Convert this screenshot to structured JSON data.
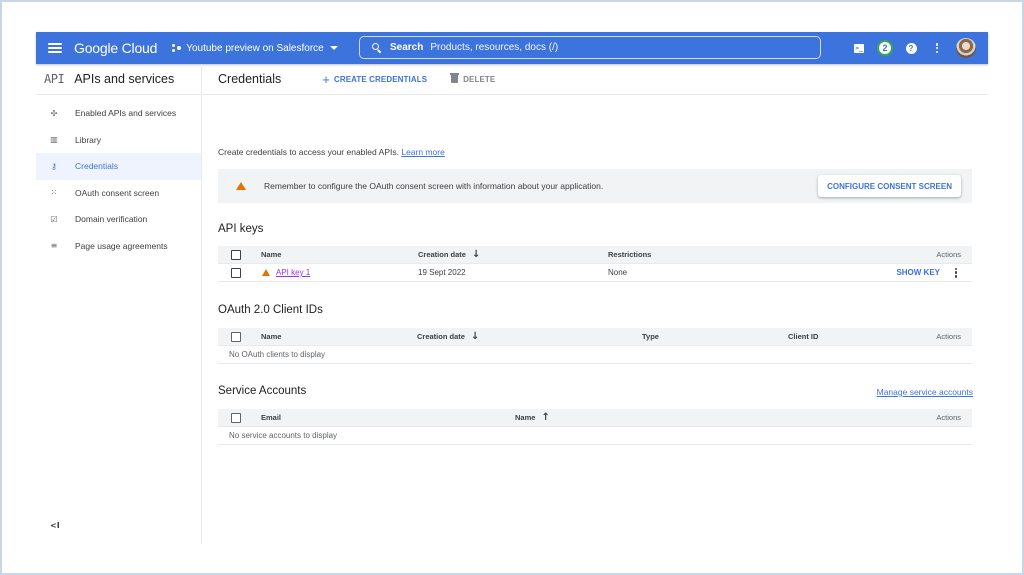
{
  "topbar": {
    "brand": "Google Cloud",
    "project": "Youtube preview on Salesforce",
    "search_label": "Search",
    "search_placeholder": "Products, resources, docs (/)",
    "notification_count": "2",
    "icons": [
      "menu-icon",
      "project-icon",
      "search-icon",
      "cloud-shell-icon",
      "notifications-icon",
      "help-icon",
      "more-vert-icon",
      "avatar"
    ],
    "colors": {
      "bar": "#3d73dc",
      "badge_ring": "#34a853"
    }
  },
  "sidebar": {
    "logo": "API",
    "title": "APIs and services",
    "items": [
      {
        "label": "Enabled APIs and services",
        "icon": "✣",
        "active": false
      },
      {
        "label": "Library",
        "icon": "▥",
        "active": false
      },
      {
        "label": "Credentials",
        "icon": "⚷",
        "active": true
      },
      {
        "label": "OAuth consent screen",
        "icon": "⁙",
        "active": false
      },
      {
        "label": "Domain verification",
        "icon": "☑",
        "active": false
      },
      {
        "label": "Page usage agreements",
        "icon": "≡",
        "active": false
      }
    ],
    "collapse_label": "<I"
  },
  "main": {
    "title": "Credentials",
    "create_label": "CREATE CREDENTIALS",
    "delete_label": "DELETE",
    "intro_text": "Create credentials to access your enabled APIs.",
    "learn_more": "Learn more",
    "banner_text": "Remember to configure the OAuth consent screen with information about your application.",
    "banner_button": "CONFIGURE CONSENT SCREEN"
  },
  "api_keys": {
    "title": "API keys",
    "columns": {
      "name": "Name",
      "created": "Creation date",
      "restrictions": "Restrictions",
      "actions": "Actions"
    },
    "rows": [
      {
        "name": "API key 1",
        "created": "19 Sept 2022",
        "restrictions": "None",
        "action": "SHOW KEY",
        "warning": true
      }
    ]
  },
  "oauth": {
    "title": "OAuth 2.0 Client IDs",
    "columns": {
      "name": "Name",
      "created": "Creation date",
      "type": "Type",
      "client_id": "Client ID",
      "actions": "Actions"
    },
    "empty": "No OAuth clients to display"
  },
  "service_accounts": {
    "title": "Service Accounts",
    "manage_link": "Manage service accounts",
    "columns": {
      "email": "Email",
      "name": "Name",
      "actions": "Actions"
    },
    "empty": "No service accounts to display"
  }
}
